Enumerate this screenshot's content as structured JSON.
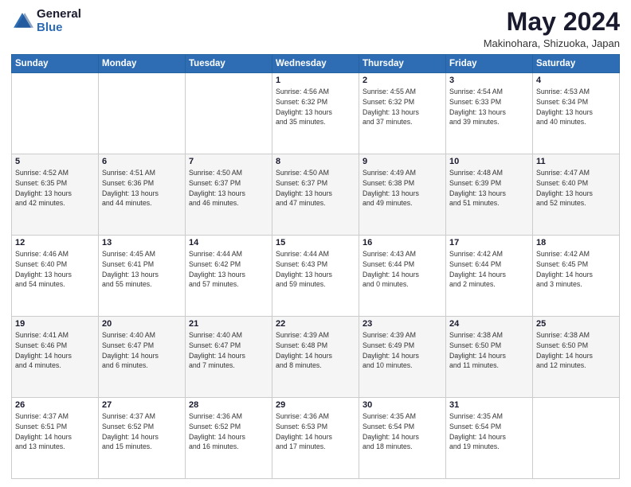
{
  "header": {
    "logo": {
      "line1": "General",
      "line2": "Blue"
    },
    "title": "May 2024",
    "location": "Makinohara, Shizuoka, Japan"
  },
  "days_of_week": [
    "Sunday",
    "Monday",
    "Tuesday",
    "Wednesday",
    "Thursday",
    "Friday",
    "Saturday"
  ],
  "weeks": [
    [
      {
        "day": "",
        "info": ""
      },
      {
        "day": "",
        "info": ""
      },
      {
        "day": "",
        "info": ""
      },
      {
        "day": "1",
        "info": "Sunrise: 4:56 AM\nSunset: 6:32 PM\nDaylight: 13 hours\nand 35 minutes."
      },
      {
        "day": "2",
        "info": "Sunrise: 4:55 AM\nSunset: 6:32 PM\nDaylight: 13 hours\nand 37 minutes."
      },
      {
        "day": "3",
        "info": "Sunrise: 4:54 AM\nSunset: 6:33 PM\nDaylight: 13 hours\nand 39 minutes."
      },
      {
        "day": "4",
        "info": "Sunrise: 4:53 AM\nSunset: 6:34 PM\nDaylight: 13 hours\nand 40 minutes."
      }
    ],
    [
      {
        "day": "5",
        "info": "Sunrise: 4:52 AM\nSunset: 6:35 PM\nDaylight: 13 hours\nand 42 minutes."
      },
      {
        "day": "6",
        "info": "Sunrise: 4:51 AM\nSunset: 6:36 PM\nDaylight: 13 hours\nand 44 minutes."
      },
      {
        "day": "7",
        "info": "Sunrise: 4:50 AM\nSunset: 6:37 PM\nDaylight: 13 hours\nand 46 minutes."
      },
      {
        "day": "8",
        "info": "Sunrise: 4:50 AM\nSunset: 6:37 PM\nDaylight: 13 hours\nand 47 minutes."
      },
      {
        "day": "9",
        "info": "Sunrise: 4:49 AM\nSunset: 6:38 PM\nDaylight: 13 hours\nand 49 minutes."
      },
      {
        "day": "10",
        "info": "Sunrise: 4:48 AM\nSunset: 6:39 PM\nDaylight: 13 hours\nand 51 minutes."
      },
      {
        "day": "11",
        "info": "Sunrise: 4:47 AM\nSunset: 6:40 PM\nDaylight: 13 hours\nand 52 minutes."
      }
    ],
    [
      {
        "day": "12",
        "info": "Sunrise: 4:46 AM\nSunset: 6:40 PM\nDaylight: 13 hours\nand 54 minutes."
      },
      {
        "day": "13",
        "info": "Sunrise: 4:45 AM\nSunset: 6:41 PM\nDaylight: 13 hours\nand 55 minutes."
      },
      {
        "day": "14",
        "info": "Sunrise: 4:44 AM\nSunset: 6:42 PM\nDaylight: 13 hours\nand 57 minutes."
      },
      {
        "day": "15",
        "info": "Sunrise: 4:44 AM\nSunset: 6:43 PM\nDaylight: 13 hours\nand 59 minutes."
      },
      {
        "day": "16",
        "info": "Sunrise: 4:43 AM\nSunset: 6:44 PM\nDaylight: 14 hours\nand 0 minutes."
      },
      {
        "day": "17",
        "info": "Sunrise: 4:42 AM\nSunset: 6:44 PM\nDaylight: 14 hours\nand 2 minutes."
      },
      {
        "day": "18",
        "info": "Sunrise: 4:42 AM\nSunset: 6:45 PM\nDaylight: 14 hours\nand 3 minutes."
      }
    ],
    [
      {
        "day": "19",
        "info": "Sunrise: 4:41 AM\nSunset: 6:46 PM\nDaylight: 14 hours\nand 4 minutes."
      },
      {
        "day": "20",
        "info": "Sunrise: 4:40 AM\nSunset: 6:47 PM\nDaylight: 14 hours\nand 6 minutes."
      },
      {
        "day": "21",
        "info": "Sunrise: 4:40 AM\nSunset: 6:47 PM\nDaylight: 14 hours\nand 7 minutes."
      },
      {
        "day": "22",
        "info": "Sunrise: 4:39 AM\nSunset: 6:48 PM\nDaylight: 14 hours\nand 8 minutes."
      },
      {
        "day": "23",
        "info": "Sunrise: 4:39 AM\nSunset: 6:49 PM\nDaylight: 14 hours\nand 10 minutes."
      },
      {
        "day": "24",
        "info": "Sunrise: 4:38 AM\nSunset: 6:50 PM\nDaylight: 14 hours\nand 11 minutes."
      },
      {
        "day": "25",
        "info": "Sunrise: 4:38 AM\nSunset: 6:50 PM\nDaylight: 14 hours\nand 12 minutes."
      }
    ],
    [
      {
        "day": "26",
        "info": "Sunrise: 4:37 AM\nSunset: 6:51 PM\nDaylight: 14 hours\nand 13 minutes."
      },
      {
        "day": "27",
        "info": "Sunrise: 4:37 AM\nSunset: 6:52 PM\nDaylight: 14 hours\nand 15 minutes."
      },
      {
        "day": "28",
        "info": "Sunrise: 4:36 AM\nSunset: 6:52 PM\nDaylight: 14 hours\nand 16 minutes."
      },
      {
        "day": "29",
        "info": "Sunrise: 4:36 AM\nSunset: 6:53 PM\nDaylight: 14 hours\nand 17 minutes."
      },
      {
        "day": "30",
        "info": "Sunrise: 4:35 AM\nSunset: 6:54 PM\nDaylight: 14 hours\nand 18 minutes."
      },
      {
        "day": "31",
        "info": "Sunrise: 4:35 AM\nSunset: 6:54 PM\nDaylight: 14 hours\nand 19 minutes."
      },
      {
        "day": "",
        "info": ""
      }
    ]
  ]
}
